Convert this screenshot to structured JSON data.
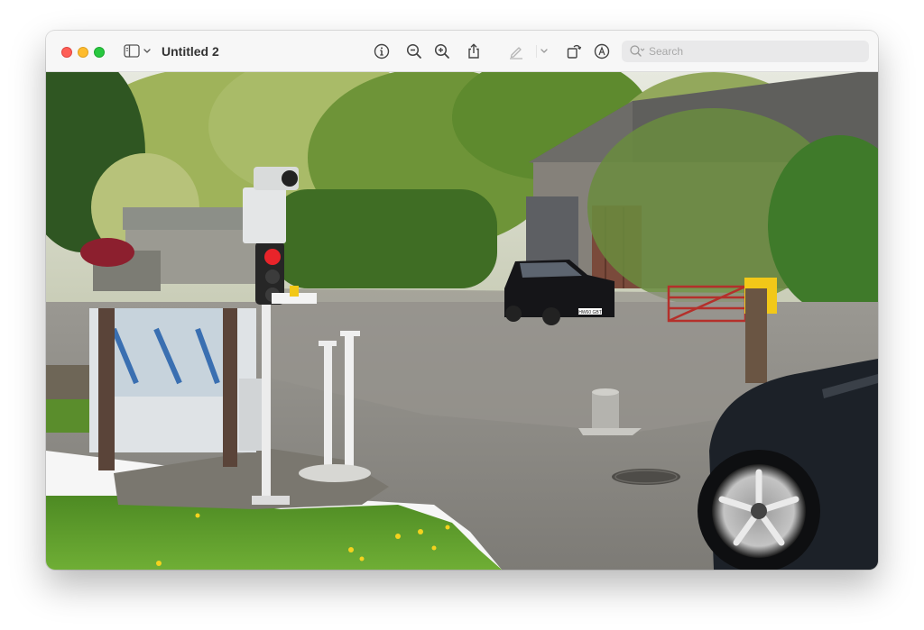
{
  "window": {
    "title": "Untitled 2"
  },
  "toolbar": {
    "sidebar_icon": "sidebar-toggle-icon",
    "chevron_icon": "chevron-down-icon",
    "buttons": [
      {
        "name": "info",
        "icon": "info-icon"
      },
      {
        "name": "zoom-out",
        "icon": "zoom-out-icon"
      },
      {
        "name": "zoom-in",
        "icon": "zoom-in-icon"
      },
      {
        "name": "share",
        "icon": "share-icon"
      },
      {
        "name": "markup",
        "icon": "pen-icon"
      },
      {
        "name": "markup-menu",
        "icon": "chevron-down-icon"
      },
      {
        "name": "rotate",
        "icon": "rotate-icon"
      },
      {
        "name": "annotate",
        "icon": "markup-circle-icon"
      }
    ]
  },
  "search": {
    "placeholder": "Search",
    "value": ""
  },
  "photo": {
    "registration_plate": "HW60 GBT",
    "colors": {
      "sky": "#e6e9de",
      "road": "#8a8882",
      "grass": "#5a9a2c",
      "traffic_light_red": "#e8242a",
      "yellow_sign": "#f2c818"
    }
  }
}
